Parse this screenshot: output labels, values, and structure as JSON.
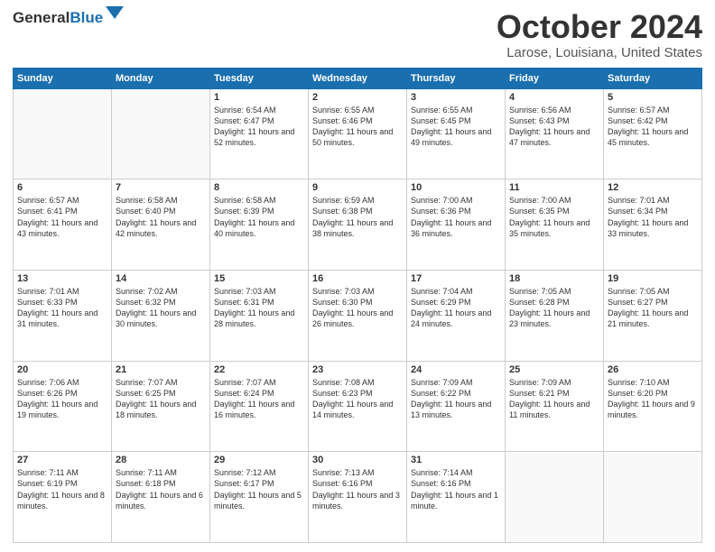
{
  "header": {
    "logo_line1": "General",
    "logo_line2": "Blue",
    "title": "October 2024",
    "subtitle": "Larose, Louisiana, United States"
  },
  "days_of_week": [
    "Sunday",
    "Monday",
    "Tuesday",
    "Wednesday",
    "Thursday",
    "Friday",
    "Saturday"
  ],
  "weeks": [
    [
      {
        "day": "",
        "info": ""
      },
      {
        "day": "",
        "info": ""
      },
      {
        "day": "1",
        "info": "Sunrise: 6:54 AM\nSunset: 6:47 PM\nDaylight: 11 hours and 52 minutes."
      },
      {
        "day": "2",
        "info": "Sunrise: 6:55 AM\nSunset: 6:46 PM\nDaylight: 11 hours and 50 minutes."
      },
      {
        "day": "3",
        "info": "Sunrise: 6:55 AM\nSunset: 6:45 PM\nDaylight: 11 hours and 49 minutes."
      },
      {
        "day": "4",
        "info": "Sunrise: 6:56 AM\nSunset: 6:43 PM\nDaylight: 11 hours and 47 minutes."
      },
      {
        "day": "5",
        "info": "Sunrise: 6:57 AM\nSunset: 6:42 PM\nDaylight: 11 hours and 45 minutes."
      }
    ],
    [
      {
        "day": "6",
        "info": "Sunrise: 6:57 AM\nSunset: 6:41 PM\nDaylight: 11 hours and 43 minutes."
      },
      {
        "day": "7",
        "info": "Sunrise: 6:58 AM\nSunset: 6:40 PM\nDaylight: 11 hours and 42 minutes."
      },
      {
        "day": "8",
        "info": "Sunrise: 6:58 AM\nSunset: 6:39 PM\nDaylight: 11 hours and 40 minutes."
      },
      {
        "day": "9",
        "info": "Sunrise: 6:59 AM\nSunset: 6:38 PM\nDaylight: 11 hours and 38 minutes."
      },
      {
        "day": "10",
        "info": "Sunrise: 7:00 AM\nSunset: 6:36 PM\nDaylight: 11 hours and 36 minutes."
      },
      {
        "day": "11",
        "info": "Sunrise: 7:00 AM\nSunset: 6:35 PM\nDaylight: 11 hours and 35 minutes."
      },
      {
        "day": "12",
        "info": "Sunrise: 7:01 AM\nSunset: 6:34 PM\nDaylight: 11 hours and 33 minutes."
      }
    ],
    [
      {
        "day": "13",
        "info": "Sunrise: 7:01 AM\nSunset: 6:33 PM\nDaylight: 11 hours and 31 minutes."
      },
      {
        "day": "14",
        "info": "Sunrise: 7:02 AM\nSunset: 6:32 PM\nDaylight: 11 hours and 30 minutes."
      },
      {
        "day": "15",
        "info": "Sunrise: 7:03 AM\nSunset: 6:31 PM\nDaylight: 11 hours and 28 minutes."
      },
      {
        "day": "16",
        "info": "Sunrise: 7:03 AM\nSunset: 6:30 PM\nDaylight: 11 hours and 26 minutes."
      },
      {
        "day": "17",
        "info": "Sunrise: 7:04 AM\nSunset: 6:29 PM\nDaylight: 11 hours and 24 minutes."
      },
      {
        "day": "18",
        "info": "Sunrise: 7:05 AM\nSunset: 6:28 PM\nDaylight: 11 hours and 23 minutes."
      },
      {
        "day": "19",
        "info": "Sunrise: 7:05 AM\nSunset: 6:27 PM\nDaylight: 11 hours and 21 minutes."
      }
    ],
    [
      {
        "day": "20",
        "info": "Sunrise: 7:06 AM\nSunset: 6:26 PM\nDaylight: 11 hours and 19 minutes."
      },
      {
        "day": "21",
        "info": "Sunrise: 7:07 AM\nSunset: 6:25 PM\nDaylight: 11 hours and 18 minutes."
      },
      {
        "day": "22",
        "info": "Sunrise: 7:07 AM\nSunset: 6:24 PM\nDaylight: 11 hours and 16 minutes."
      },
      {
        "day": "23",
        "info": "Sunrise: 7:08 AM\nSunset: 6:23 PM\nDaylight: 11 hours and 14 minutes."
      },
      {
        "day": "24",
        "info": "Sunrise: 7:09 AM\nSunset: 6:22 PM\nDaylight: 11 hours and 13 minutes."
      },
      {
        "day": "25",
        "info": "Sunrise: 7:09 AM\nSunset: 6:21 PM\nDaylight: 11 hours and 11 minutes."
      },
      {
        "day": "26",
        "info": "Sunrise: 7:10 AM\nSunset: 6:20 PM\nDaylight: 11 hours and 9 minutes."
      }
    ],
    [
      {
        "day": "27",
        "info": "Sunrise: 7:11 AM\nSunset: 6:19 PM\nDaylight: 11 hours and 8 minutes."
      },
      {
        "day": "28",
        "info": "Sunrise: 7:11 AM\nSunset: 6:18 PM\nDaylight: 11 hours and 6 minutes."
      },
      {
        "day": "29",
        "info": "Sunrise: 7:12 AM\nSunset: 6:17 PM\nDaylight: 11 hours and 5 minutes."
      },
      {
        "day": "30",
        "info": "Sunrise: 7:13 AM\nSunset: 6:16 PM\nDaylight: 11 hours and 3 minutes."
      },
      {
        "day": "31",
        "info": "Sunrise: 7:14 AM\nSunset: 6:16 PM\nDaylight: 11 hours and 1 minute."
      },
      {
        "day": "",
        "info": ""
      },
      {
        "day": "",
        "info": ""
      }
    ]
  ]
}
